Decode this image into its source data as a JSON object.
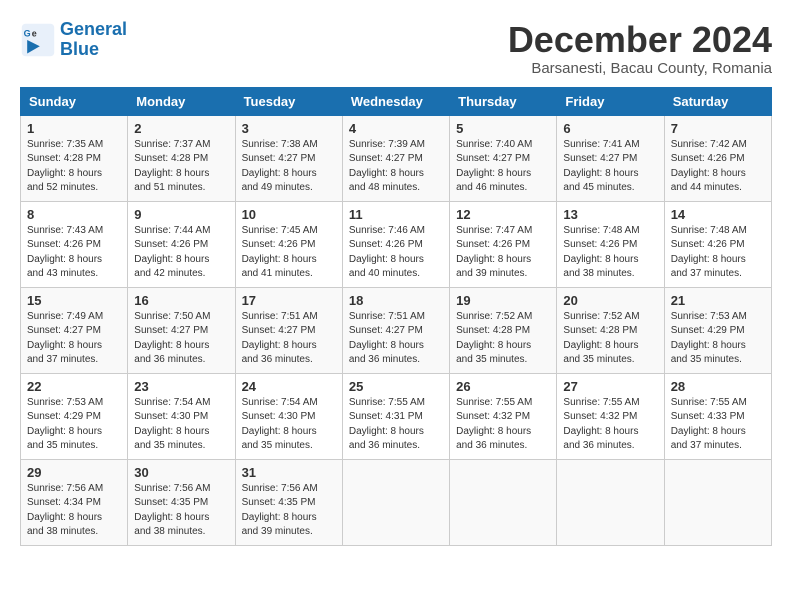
{
  "logo": {
    "line1": "General",
    "line2": "Blue"
  },
  "title": "December 2024",
  "subtitle": "Barsanesti, Bacau County, Romania",
  "days_of_week": [
    "Sunday",
    "Monday",
    "Tuesday",
    "Wednesday",
    "Thursday",
    "Friday",
    "Saturday"
  ],
  "weeks": [
    [
      {
        "day": "1",
        "sunrise": "7:35 AM",
        "sunset": "4:28 PM",
        "daylight": "8 hours and 52 minutes."
      },
      {
        "day": "2",
        "sunrise": "7:37 AM",
        "sunset": "4:28 PM",
        "daylight": "8 hours and 51 minutes."
      },
      {
        "day": "3",
        "sunrise": "7:38 AM",
        "sunset": "4:27 PM",
        "daylight": "8 hours and 49 minutes."
      },
      {
        "day": "4",
        "sunrise": "7:39 AM",
        "sunset": "4:27 PM",
        "daylight": "8 hours and 48 minutes."
      },
      {
        "day": "5",
        "sunrise": "7:40 AM",
        "sunset": "4:27 PM",
        "daylight": "8 hours and 46 minutes."
      },
      {
        "day": "6",
        "sunrise": "7:41 AM",
        "sunset": "4:27 PM",
        "daylight": "8 hours and 45 minutes."
      },
      {
        "day": "7",
        "sunrise": "7:42 AM",
        "sunset": "4:26 PM",
        "daylight": "8 hours and 44 minutes."
      }
    ],
    [
      {
        "day": "8",
        "sunrise": "7:43 AM",
        "sunset": "4:26 PM",
        "daylight": "8 hours and 43 minutes."
      },
      {
        "day": "9",
        "sunrise": "7:44 AM",
        "sunset": "4:26 PM",
        "daylight": "8 hours and 42 minutes."
      },
      {
        "day": "10",
        "sunrise": "7:45 AM",
        "sunset": "4:26 PM",
        "daylight": "8 hours and 41 minutes."
      },
      {
        "day": "11",
        "sunrise": "7:46 AM",
        "sunset": "4:26 PM",
        "daylight": "8 hours and 40 minutes."
      },
      {
        "day": "12",
        "sunrise": "7:47 AM",
        "sunset": "4:26 PM",
        "daylight": "8 hours and 39 minutes."
      },
      {
        "day": "13",
        "sunrise": "7:48 AM",
        "sunset": "4:26 PM",
        "daylight": "8 hours and 38 minutes."
      },
      {
        "day": "14",
        "sunrise": "7:48 AM",
        "sunset": "4:26 PM",
        "daylight": "8 hours and 37 minutes."
      }
    ],
    [
      {
        "day": "15",
        "sunrise": "7:49 AM",
        "sunset": "4:27 PM",
        "daylight": "8 hours and 37 minutes."
      },
      {
        "day": "16",
        "sunrise": "7:50 AM",
        "sunset": "4:27 PM",
        "daylight": "8 hours and 36 minutes."
      },
      {
        "day": "17",
        "sunrise": "7:51 AM",
        "sunset": "4:27 PM",
        "daylight": "8 hours and 36 minutes."
      },
      {
        "day": "18",
        "sunrise": "7:51 AM",
        "sunset": "4:27 PM",
        "daylight": "8 hours and 36 minutes."
      },
      {
        "day": "19",
        "sunrise": "7:52 AM",
        "sunset": "4:28 PM",
        "daylight": "8 hours and 35 minutes."
      },
      {
        "day": "20",
        "sunrise": "7:52 AM",
        "sunset": "4:28 PM",
        "daylight": "8 hours and 35 minutes."
      },
      {
        "day": "21",
        "sunrise": "7:53 AM",
        "sunset": "4:29 PM",
        "daylight": "8 hours and 35 minutes."
      }
    ],
    [
      {
        "day": "22",
        "sunrise": "7:53 AM",
        "sunset": "4:29 PM",
        "daylight": "8 hours and 35 minutes."
      },
      {
        "day": "23",
        "sunrise": "7:54 AM",
        "sunset": "4:30 PM",
        "daylight": "8 hours and 35 minutes."
      },
      {
        "day": "24",
        "sunrise": "7:54 AM",
        "sunset": "4:30 PM",
        "daylight": "8 hours and 35 minutes."
      },
      {
        "day": "25",
        "sunrise": "7:55 AM",
        "sunset": "4:31 PM",
        "daylight": "8 hours and 36 minutes."
      },
      {
        "day": "26",
        "sunrise": "7:55 AM",
        "sunset": "4:32 PM",
        "daylight": "8 hours and 36 minutes."
      },
      {
        "day": "27",
        "sunrise": "7:55 AM",
        "sunset": "4:32 PM",
        "daylight": "8 hours and 36 minutes."
      },
      {
        "day": "28",
        "sunrise": "7:55 AM",
        "sunset": "4:33 PM",
        "daylight": "8 hours and 37 minutes."
      }
    ],
    [
      {
        "day": "29",
        "sunrise": "7:56 AM",
        "sunset": "4:34 PM",
        "daylight": "8 hours and 38 minutes."
      },
      {
        "day": "30",
        "sunrise": "7:56 AM",
        "sunset": "4:35 PM",
        "daylight": "8 hours and 38 minutes."
      },
      {
        "day": "31",
        "sunrise": "7:56 AM",
        "sunset": "4:35 PM",
        "daylight": "8 hours and 39 minutes."
      },
      null,
      null,
      null,
      null
    ]
  ]
}
